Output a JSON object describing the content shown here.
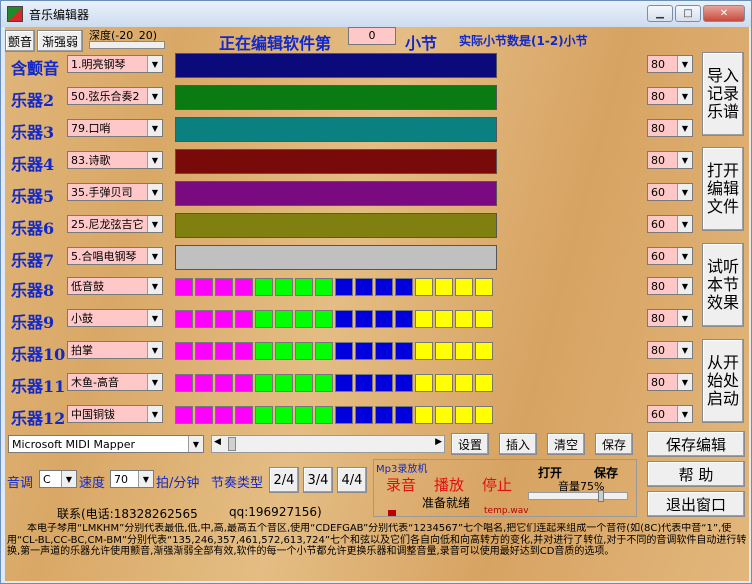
{
  "window": {
    "title": "音乐编辑器"
  },
  "top": {
    "btn_tremolo": "颤音",
    "btn_fade": "渐强弱",
    "depth_label": "深度(-20_20)",
    "editing_prefix": "正在编辑软件第",
    "bar_number": "0",
    "editing_suffix": "小节",
    "actual_bars": "实际小节数是(1-2)小节"
  },
  "rows": [
    {
      "label": "含颤音",
      "instrument": "1.明亮钢琴",
      "color": "#0a0a7a",
      "volume": "80"
    },
    {
      "label": "乐器2",
      "instrument": "50.弦乐合奏2",
      "color": "#0a7a12",
      "volume": "80"
    },
    {
      "label": "乐器3",
      "instrument": "79.口哨",
      "color": "#0a8080",
      "volume": "80"
    },
    {
      "label": "乐器4",
      "instrument": "83.诗歌",
      "color": "#780a0a",
      "volume": "80"
    },
    {
      "label": "乐器5",
      "instrument": "35.手弹贝司",
      "color": "#7a0a80",
      "volume": "60"
    },
    {
      "label": "乐器6",
      "instrument": "25.尼龙弦吉它",
      "color": "#808010",
      "volume": "60"
    },
    {
      "label": "乐器7",
      "instrument": "5.合唱电钢琴",
      "color": "#c0c0c0",
      "volume": "60"
    },
    {
      "label": "乐器8",
      "instrument": "低音鼓",
      "volume": "80"
    },
    {
      "label": "乐器9",
      "instrument": "小鼓",
      "volume": "80"
    },
    {
      "label": "乐器10",
      "instrument": "拍掌",
      "volume": "80"
    },
    {
      "label": "乐器11",
      "instrument": "木鱼-高音",
      "volume": "80"
    },
    {
      "label": "乐器12",
      "instrument": "中国铜钹",
      "volume": "60"
    }
  ],
  "drum_colors": [
    "#ff00ff",
    "#00ff00",
    "#0000dd",
    "#ffff00"
  ],
  "side_buttons": {
    "import": "导入记录乐谱",
    "open": "打开编辑文件",
    "preview": "试听本节效果",
    "restart": "从开始处启动"
  },
  "midi": {
    "device": "Microsoft MIDI Mapper",
    "btn_settings": "设置",
    "btn_insert": "插入",
    "btn_clear": "清空",
    "btn_save": "保存"
  },
  "right_buttons": {
    "save_edit": "保存编辑",
    "help": "帮  助",
    "exit": "退出窗口"
  },
  "controls": {
    "key_label": "音调",
    "key_value": "C",
    "tempo_label": "速度",
    "tempo_value": "70",
    "tempo_unit": "拍/分钟",
    "meter_label": "节奏类型",
    "meter_24": "2/4",
    "meter_34": "3/4",
    "meter_44": "4/4"
  },
  "mp3": {
    "title": "Mp3录放机",
    "record": "录音",
    "play": "播放",
    "stop": "停止",
    "open": "打开",
    "save": "保存",
    "volume_label": "音量75%",
    "volume_level": 0.75,
    "status": "准备就绪",
    "file": "temp.wav"
  },
  "contact": {
    "phone": "联系(电话:18328262565",
    "qq": "qq:196927156)"
  },
  "notes": "本电子琴用“LMKHM”分别代表最低,低,中,高,最高五个音区,使用“CDEFGAB”分别代表“1234567”七个唱名,把它们连起来组成一个音符(如(8C)代表中音“1”,使用“CL-BL,CC-BC,CM-BM”分别代表“135,246,357,461,572,613,724”七个和弦以及它们各自向低和向高转方的变化,并对进行了转位,对于不同的音调软件自动进行转换,第一声道的乐器允许使用颤音,渐强渐弱全部有效,软件的每一个小节都允许更换乐器和调整音量,录音可以使用最好达到CD音质的选项。"
}
